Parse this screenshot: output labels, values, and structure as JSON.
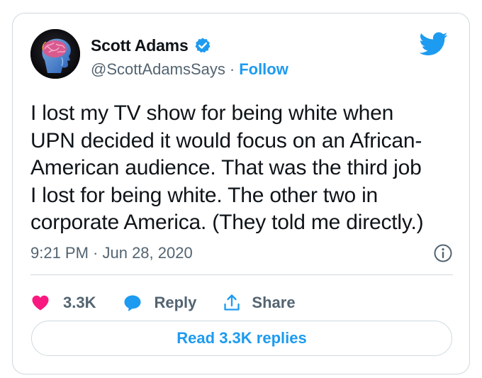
{
  "author": {
    "display_name": "Scott Adams",
    "handle": "@ScottAdamsSays",
    "separator": "·",
    "follow_label": "Follow",
    "verified": true
  },
  "tweet": {
    "text_lines": [
      "I lost my TV show for being white when",
      "UPN decided it would focus on an African-",
      "American audience. That was the third job",
      "I lost for being white. The other two in",
      "corporate America. (They told me directly.)"
    ],
    "timestamp": "9:21 PM · Jun 28, 2020"
  },
  "actions": {
    "like_count": "3.3K",
    "reply_label": "Reply",
    "share_label": "Share"
  },
  "read_replies_label": "Read 3.3K replies",
  "icons": {
    "avatar": "brain-profile-avatar",
    "verified": "verified-badge-icon",
    "brand": "twitter-bird-icon",
    "info": "info-icon",
    "like": "heart-icon",
    "reply": "speech-bubble-icon",
    "share": "share-upload-icon"
  },
  "colors": {
    "brand_blue": "#1d9bf0",
    "like_red": "#f91880",
    "text_primary": "#0f1419",
    "text_secondary": "#536471",
    "border": "#cfd9de"
  }
}
